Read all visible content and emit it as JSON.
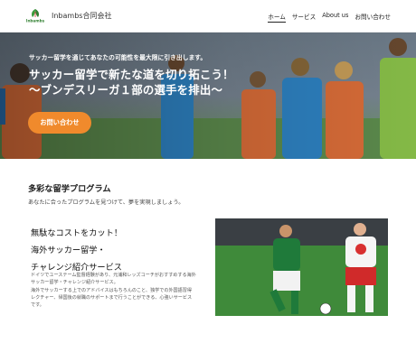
{
  "header": {
    "logo_text": "Inbambs",
    "brand": "Inbambs合同会社",
    "nav": [
      {
        "label": "ホーム",
        "active": true
      },
      {
        "label": "サービス",
        "active": false
      },
      {
        "label": "About us",
        "active": false
      },
      {
        "label": "お問い合わせ",
        "active": false
      }
    ]
  },
  "hero": {
    "subtitle": "サッカー留学を通じてあなたの可能性を最大限に引き出します。",
    "title_line1": "サッカー留学で新たな道を切り拓こう！",
    "title_line2": "〜ブンデスリーガ１部の選手を排出〜",
    "cta": "お問い合わせ",
    "cta_color": "#f08a2c"
  },
  "section": {
    "title": "多彩な留学プログラム",
    "description": "あなたに合ったプログラムを見つけて、夢を実現しましょう。"
  },
  "card": {
    "title_line1": "無駄なコストをカット！",
    "title_line2": "海外サッカー留学・",
    "title_line3": "チャレンジ紹介サービス",
    "body_line1": "ドイツでユーステーム監督経験があり、元浦和レッズコーチがおすすめする海外",
    "body_line2": "サッカー留学・チャレンジ紹介サービス。",
    "body_line3": "海外でサッカーする上でのアドバイスはもちろんのこと、独学での外国語習得",
    "body_line4": "レクチャー、帰国後の就職のサポートまで行うことができる、心強いサービス",
    "body_line5": "です。"
  }
}
